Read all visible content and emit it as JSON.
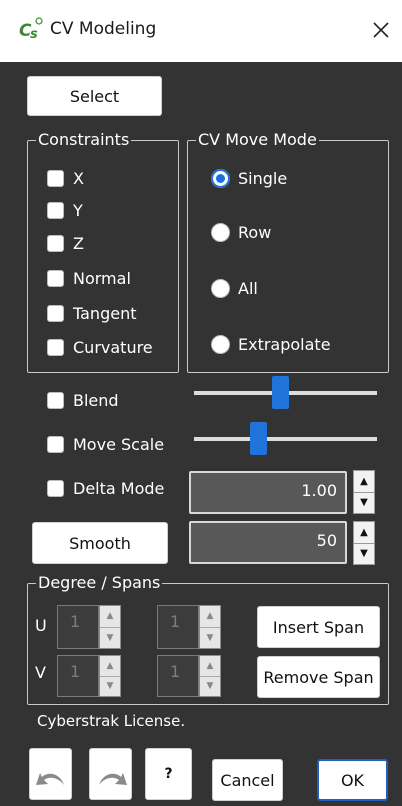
{
  "window": {
    "title": "CV Modeling"
  },
  "select_button": "Select",
  "constraints": {
    "title": "Constraints",
    "items": [
      "X",
      "Y",
      "Z",
      "Normal",
      "Tangent",
      "Curvature"
    ]
  },
  "move_mode": {
    "title": "CV Move Mode",
    "options": [
      "Single",
      "Row",
      "All",
      "Extrapolate"
    ],
    "selected": "Single"
  },
  "blend": {
    "label": "Blend",
    "slider_fraction": 0.47
  },
  "move_scale": {
    "label": "Move Scale",
    "slider_fraction": 0.34
  },
  "delta_mode": {
    "label": "Delta Mode",
    "value": "1.00"
  },
  "smooth": {
    "label": "Smooth",
    "value": "50"
  },
  "degree_spans": {
    "title": "Degree / Spans",
    "u_label": "U",
    "v_label": "V",
    "u_degree": "1",
    "u_spans": "1",
    "v_degree": "1",
    "v_spans": "1",
    "insert_span": "Insert Span",
    "remove_span": "Remove Span"
  },
  "license_text": "Cyberstrak License.",
  "footer": {
    "help": "?",
    "cancel": "Cancel",
    "ok": "OK"
  }
}
